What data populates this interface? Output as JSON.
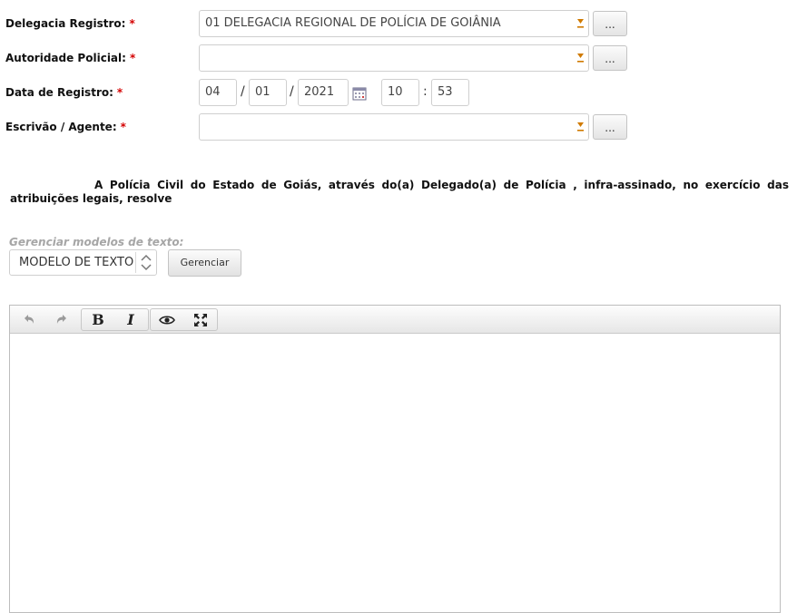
{
  "form": {
    "delegacia": {
      "label": "Delegacia Registro:",
      "required_mark": "*",
      "value": "01 DELEGACIA REGIONAL DE POLÍCIA DE GOIÂNIA",
      "lookup_label": "..."
    },
    "autoridade": {
      "label": "Autoridade Policial:",
      "required_mark": "*",
      "value": "",
      "lookup_label": "..."
    },
    "data": {
      "label": "Data de Registro:",
      "required_mark": "*",
      "day": "04",
      "month": "01",
      "year": "2021",
      "hour": "10",
      "minute": "53",
      "date_sep": "/",
      "time_sep": ":"
    },
    "escrivao": {
      "label": "Escrivão / Agente:",
      "required_mark": "*",
      "value": "",
      "lookup_label": "..."
    }
  },
  "statement": "A Polícia Civil do Estado de Goiás, através do(a) Delegado(a) de Polícia , infra-assinado, no exercício das atribuições legais, resolve",
  "templates": {
    "label": "Gerenciar modelos de texto:",
    "selected": "MODELO DE TEXTO",
    "manage_button": "Gerenciar"
  },
  "editor": {
    "toolbar": {
      "undo_icon": "undo-icon",
      "redo_icon": "redo-icon",
      "bold_glyph": "B",
      "italic_glyph": "I",
      "preview_icon": "eye-icon",
      "fullscreen_icon": "fullscreen-icon"
    },
    "content": ""
  },
  "colors": {
    "required": "#d40000",
    "dropdown_arrow": "#d07a00",
    "muted_label": "#a6a6a6"
  }
}
